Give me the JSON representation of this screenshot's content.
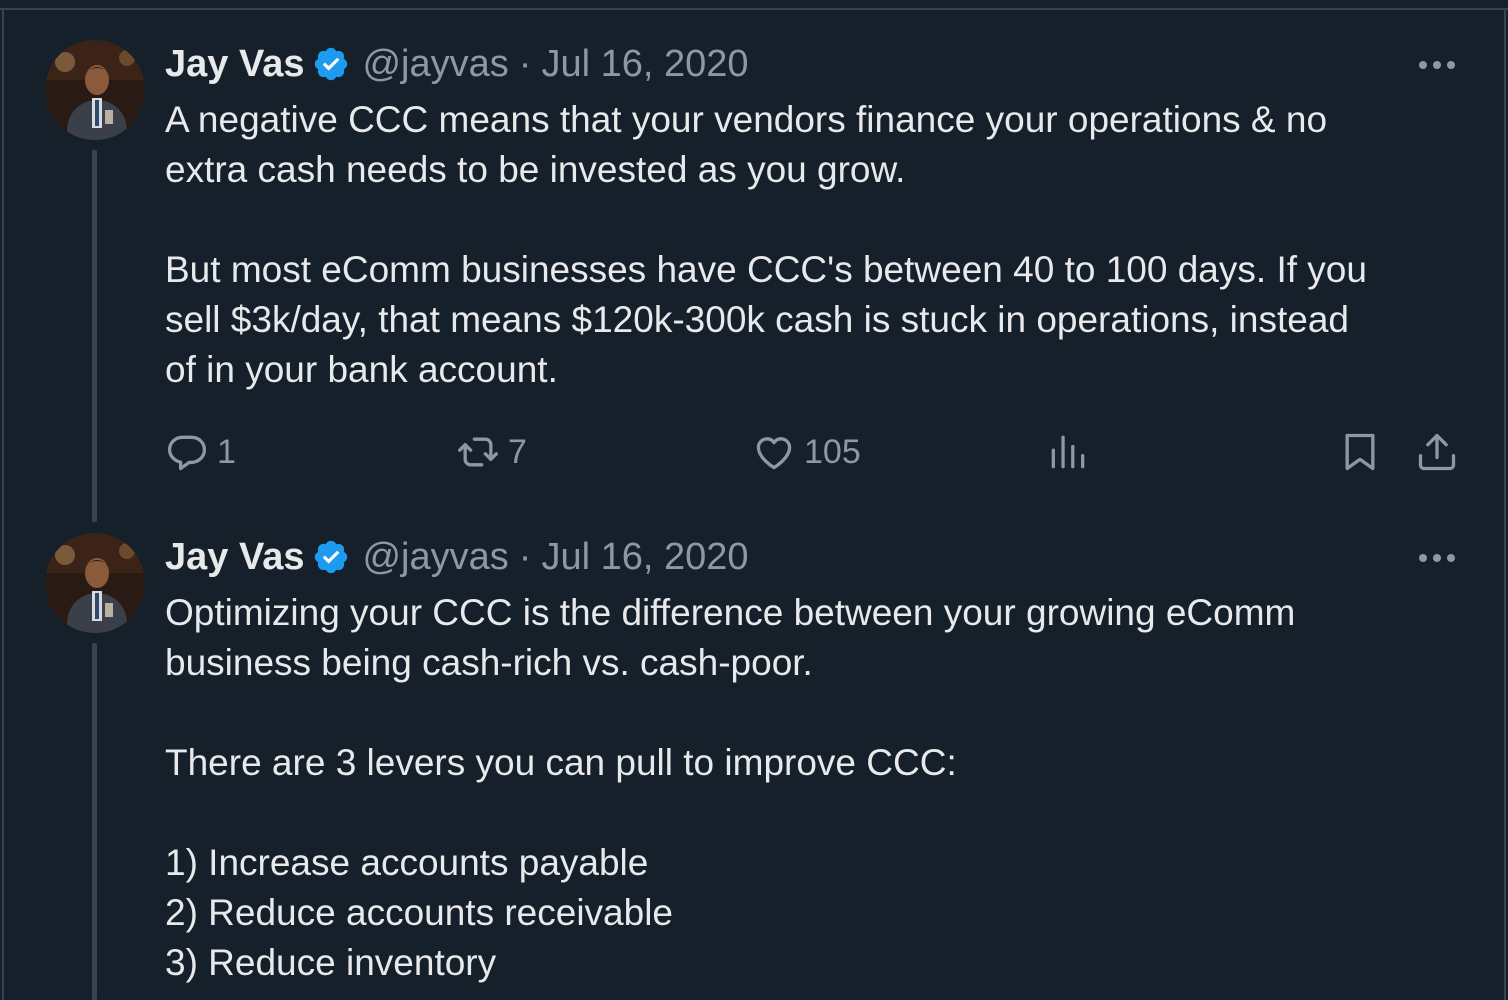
{
  "tweets": [
    {
      "author_name": "Jay Vas",
      "handle": "@jayvas",
      "separator": "·",
      "date": "Jul 16, 2020",
      "paragraphs": [
        [
          "A negative CCC means that your vendors finance your operations & no",
          "extra cash needs to be invested as you grow."
        ],
        [
          "But most eComm businesses have CCC's between 40 to 100 days. If you",
          "sell $3k/day, that means $120k-300k cash is stuck in operations, instead",
          "of in your bank account."
        ]
      ],
      "actions": {
        "replies": "1",
        "retweets": "7",
        "likes": "105"
      }
    },
    {
      "author_name": "Jay Vas",
      "handle": "@jayvas",
      "separator": "·",
      "date": "Jul 16, 2020",
      "paragraphs": [
        [
          "Optimizing your CCC is the difference between your growing eComm",
          "business being cash-rich vs. cash-poor."
        ],
        [
          "There are 3 levers you can pull to improve CCC:"
        ],
        [
          "1) Increase accounts payable",
          "2) Reduce accounts receivable",
          "3) Reduce inventory"
        ]
      ]
    }
  ],
  "colors": {
    "background": "#15202b",
    "text": "#e7e9ea",
    "secondary": "#8b98a5",
    "verified": "#1d9bf0",
    "border": "#38444d"
  },
  "icons": [
    "verified-badge-icon",
    "more-icon",
    "reply-icon",
    "retweet-icon",
    "like-icon",
    "views-icon",
    "bookmark-icon",
    "share-icon"
  ]
}
